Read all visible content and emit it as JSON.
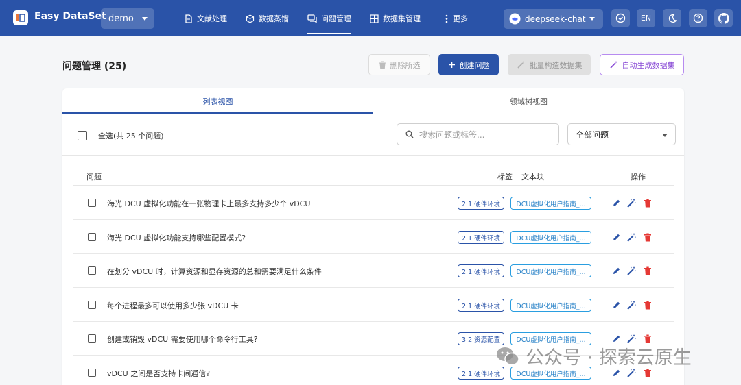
{
  "app": {
    "name": "Easy DataSet",
    "project": "demo"
  },
  "nav": [
    {
      "label": "文献处理",
      "icon": "document-icon"
    },
    {
      "label": "数据蒸馏",
      "icon": "cube-icon"
    },
    {
      "label": "问题管理",
      "icon": "chat-icon",
      "active": true
    },
    {
      "label": "数据集管理",
      "icon": "grid-icon"
    },
    {
      "label": "更多",
      "icon": "more-vertical-icon"
    }
  ],
  "model": {
    "label": "deepseek-chat"
  },
  "header_buttons": {
    "lang": "EN"
  },
  "page": {
    "title": "问题管理 (25)"
  },
  "actions": {
    "delete": "删除所选",
    "create": "创建问题",
    "batch": "批量构造数据集",
    "auto": "自动生成数据集"
  },
  "tabs": [
    {
      "label": "列表视图",
      "active": true
    },
    {
      "label": "领域树视图",
      "active": false
    }
  ],
  "select_all": "全选(共 25 个问题)",
  "search": {
    "placeholder": "搜索问题或标签..."
  },
  "filter": {
    "value": "全部问题"
  },
  "table": {
    "headers": {
      "question": "问题",
      "tag": "标签",
      "chunk": "文本块",
      "ops": "操作"
    },
    "rows": [
      {
        "question": "海光 DCU 虚拟化功能在一张物理卡上最多支持多少个 vDCU",
        "tag": "2.1 硬件环境",
        "chunk": "DCU虚拟化用户指南_..."
      },
      {
        "question": "海光 DCU 虚拟化功能支持哪些配置模式?",
        "tag": "2.1 硬件环境",
        "chunk": "DCU虚拟化用户指南_..."
      },
      {
        "question": "在划分 vDCU 时，计算资源和显存资源的总和需要满足什么条件",
        "tag": "2.1 硬件环境",
        "chunk": "DCU虚拟化用户指南_..."
      },
      {
        "question": "每个进程最多可以使用多少张 vDCU 卡",
        "tag": "2.1 硬件环境",
        "chunk": "DCU虚拟化用户指南_..."
      },
      {
        "question": "创建或销毁 vDCU 需要使用哪个命令行工具?",
        "tag": "3.2 资源配置",
        "chunk": "DCU虚拟化用户指南_..."
      },
      {
        "question": "vDCU 之间是否支持卡间通信?",
        "tag": "2.1 硬件环境",
        "chunk": "DCU虚拟化用户指南_..."
      }
    ]
  },
  "watermark": {
    "text": "公众号 · 探索云原生"
  },
  "colors": {
    "primary": "#2a53a8",
    "delete": "#e53935",
    "accent_purple": "#8a4cd6"
  }
}
